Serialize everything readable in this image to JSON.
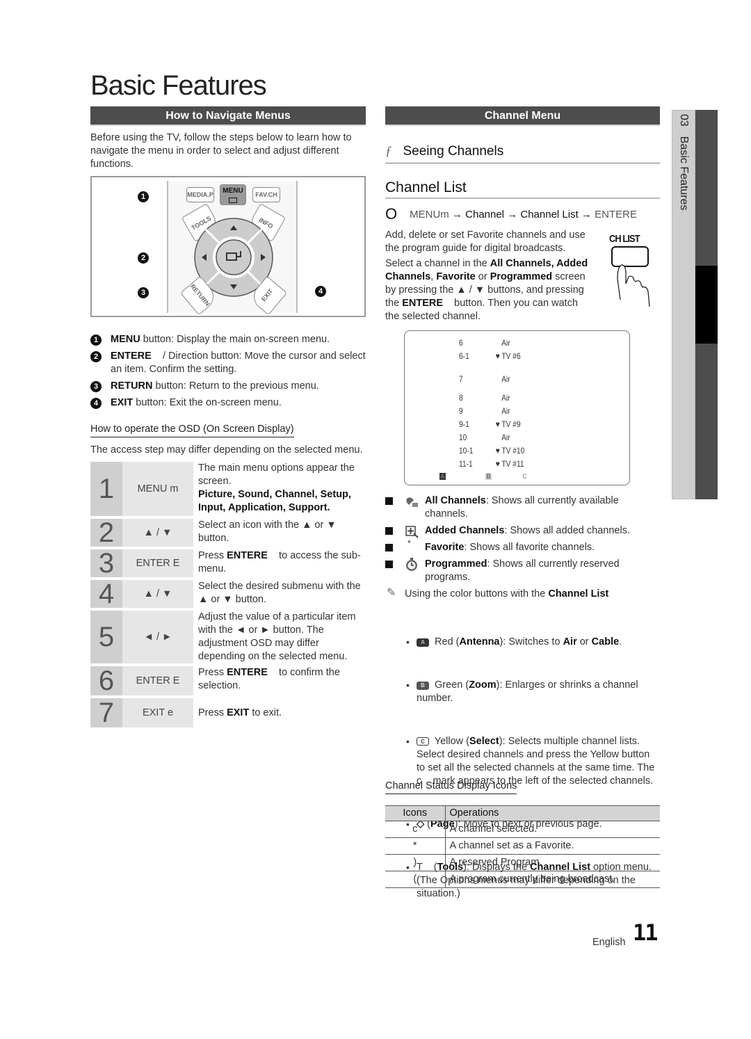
{
  "page_title": "Basic Features",
  "left": {
    "section_title": "How to Navigate Menus",
    "intro": "Before using the TV, follow the steps below to learn how to navigate the menu in order to select and adjust different functions.",
    "remote": {
      "buttons": [
        "MEDIA.P",
        "MENU",
        "FAV.CH",
        "TOOLS",
        "INFO",
        "RETURN",
        "EXIT"
      ],
      "callouts": [
        "1",
        "2",
        "3",
        "4"
      ]
    },
    "numbered": [
      {
        "n": "1",
        "key": "MENU",
        "text": " button: Display the main on-screen menu."
      },
      {
        "n": "2",
        "key": "ENTERE",
        "text": "    / Direction button: Move the cursor and select an item. Confirm the setting."
      },
      {
        "n": "3",
        "key": "RETURN",
        "text": " button: Return to the previous menu."
      },
      {
        "n": "4",
        "key": "EXIT",
        "text": " button: Exit the on-screen menu."
      }
    ],
    "osd_heading": "How to operate the OSD (On Screen Display)",
    "osd_note": "The access step may differ depending on the selected menu.",
    "osd_steps": [
      {
        "num": "1",
        "key": "MENU m",
        "desc": "The main menu options appear the screen.",
        "desc_bold": "Picture, Sound, Channel, Setup, Input, Application, Support."
      },
      {
        "num": "2",
        "key": "▲ / ▼",
        "desc": "Select an icon with the ▲ or ▼ button."
      },
      {
        "num": "3",
        "key": "ENTER E",
        "pre": "Press ",
        "bold": "ENTERE",
        "post": "    to access the sub-menu."
      },
      {
        "num": "4",
        "key": "▲ / ▼",
        "desc": "Select the desired submenu with the ▲ or ▼ button."
      },
      {
        "num": "5",
        "key": "◄ / ►",
        "desc": "Adjust the value of a particular item with the ◄ or ► button. The adjustment OSD may differ depending on the selected menu."
      },
      {
        "num": "6",
        "key": "ENTER E",
        "pre": "Press ",
        "bold": "ENTERE",
        "post": "    to confirm the selection."
      },
      {
        "num": "7",
        "key": "EXIT e",
        "pre": "Press ",
        "bold": "EXIT",
        "post": " to exit."
      }
    ]
  },
  "right": {
    "section_title": "Channel Menu",
    "seeing_symbol": "ƒ",
    "seeing_heading": "Seeing Channels",
    "channel_list_title": "Channel List",
    "path": {
      "symbol": "O",
      "menu": "MENUm",
      "arrow": " → ",
      "channel": "Channel",
      "channel_list": "Channel List",
      "enter": "ENTERE"
    },
    "desc1": "Add, delete or set Favorite channels and use the program guide for digital broadcasts.",
    "desc2": {
      "t1": "Select a channel in the ",
      "b1": "All Channels, Added Channels",
      "t2": ", ",
      "b2": "Favorite",
      "t3": " or ",
      "b3": "Programmed",
      "t4": " screen by pressing the ▲ / ▼ buttons, and pressing the ",
      "b4": "ENTERE",
      "t5": "    button. Then you can watch the selected channel."
    },
    "ch_list_button": "CH LIST",
    "channel_rows": [
      {
        "num": "6",
        "name": "Air",
        "fav": false
      },
      {
        "num": "6-1",
        "name": "TV #6",
        "fav": true
      },
      {
        "num": "7",
        "name": "Air",
        "fav": false
      },
      {
        "num": "8",
        "name": "Air",
        "fav": false
      },
      {
        "num": "9",
        "name": "Air",
        "fav": false
      },
      {
        "num": "9-1",
        "name": "TV #9",
        "fav": true
      },
      {
        "num": "10",
        "name": "Air",
        "fav": false
      },
      {
        "num": "10-1",
        "name": "TV #10",
        "fav": true
      },
      {
        "num": "11-1",
        "name": "TV #11",
        "fav": true
      }
    ],
    "channel_box_keys": [
      "A",
      "B",
      "C"
    ],
    "fav_glyph": "♥",
    "features": [
      {
        "icon": "all-channels",
        "bold": "All Channels",
        "text": ": Shows all currently available channels."
      },
      {
        "icon": "added-channels",
        "bold": "Added Channels",
        "text": ": Shows all added channels."
      },
      {
        "icon": "*",
        "bold": "Favorite",
        "text": ": Shows all favorite channels."
      },
      {
        "icon": "programmed",
        "bold": "Programmed",
        "text": ": Shows all currently reserved programs."
      }
    ],
    "note": {
      "text": "Using the color buttons with the ",
      "bold": "Channel List"
    },
    "color_buttons": [
      {
        "key": "A",
        "t1": " Red (",
        "b1": "Antenna",
        "t2": "): Switches to ",
        "b2": "Air",
        "t3": " or ",
        "b3": "Cable",
        "t4": "."
      },
      {
        "key": "B",
        "t1": " Green (",
        "b1": "Zoom",
        "t2": "): Enlarges or shrinks a channel number."
      },
      {
        "key": "C",
        "t1": " Yellow (",
        "b1": "Select",
        "t2": "): Selects multiple channel lists. Select desired channels and press the Yellow button to set all the selected channels at the same time. The c    mark appears to the left of the selected channels."
      },
      {
        "key": "◇",
        "t1": " (",
        "b1": "Page",
        "t2": "): Move to next or previous page."
      },
      {
        "key": "T",
        "t1": "    (",
        "b1": "Tools",
        "t2": "): Displays the ",
        "b2": "Channel List",
        "t3": " option menu. (The Options menus may differ depending on the situation.)"
      }
    ],
    "status_heading": "Channel Status Display Icons",
    "status_table": {
      "headers": [
        "Icons",
        "Operations"
      ],
      "rows": [
        [
          "c",
          "A channel selected."
        ],
        [
          "*",
          "A channel set as a Favorite."
        ],
        [
          ")",
          "A reserved Program."
        ],
        [
          "(",
          "A program currently being broadcast."
        ]
      ]
    }
  },
  "side_tab": {
    "chapter": "03",
    "label": "Basic Features"
  },
  "footer": {
    "language": "English",
    "page_number": "11"
  }
}
